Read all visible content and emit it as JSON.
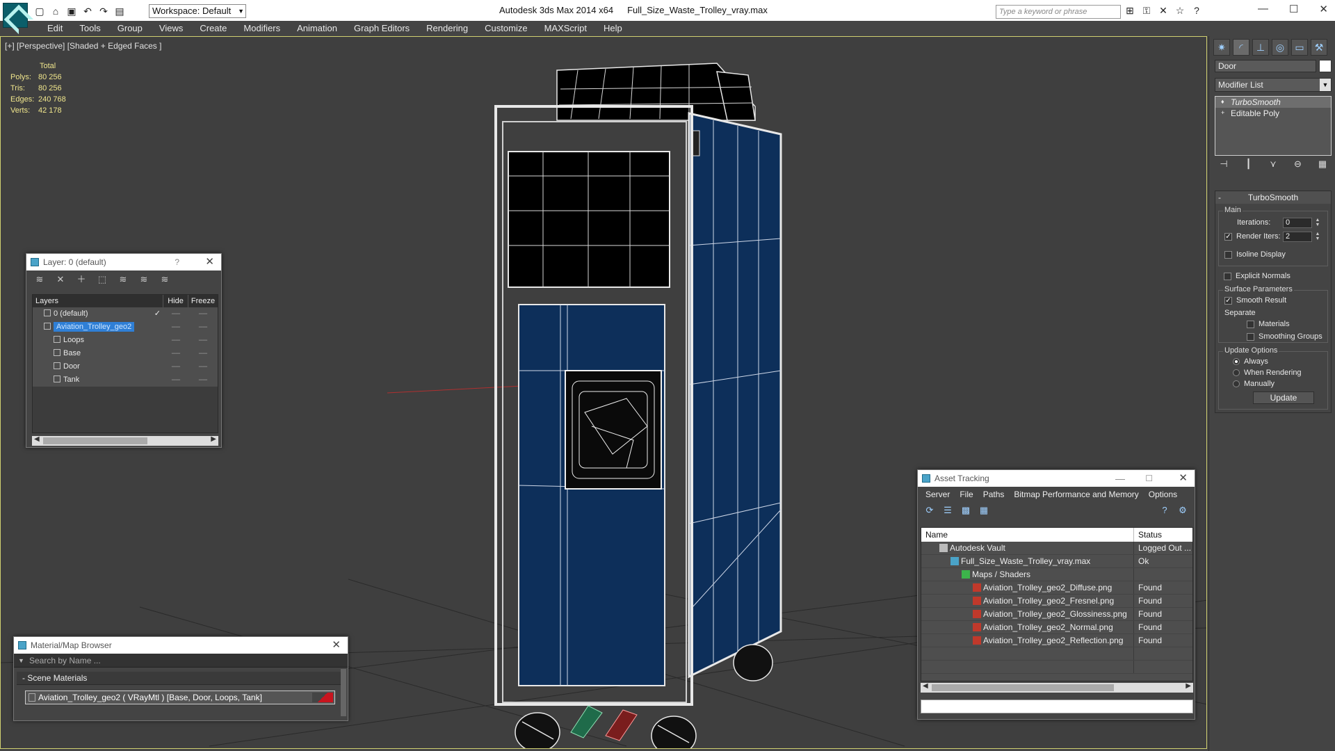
{
  "titlebar": {
    "workspace": "Workspace: Default",
    "app_name": "Autodesk 3ds Max  2014 x64",
    "file_name": "Full_Size_Waste_Trolley_vray.max",
    "search_placeholder": "Type a keyword or phrase"
  },
  "menu": [
    "Edit",
    "Tools",
    "Group",
    "Views",
    "Create",
    "Modifiers",
    "Animation",
    "Graph Editors",
    "Rendering",
    "Customize",
    "MAXScript",
    "Help"
  ],
  "viewport": {
    "label": "[+] [Perspective] [Shaded + Edged Faces ]",
    "stats_header": "Total",
    "stats": [
      {
        "k": "Polys:",
        "v": "80 256"
      },
      {
        "k": "Tris:",
        "v": "80 256"
      },
      {
        "k": "Edges:",
        "v": "240 768"
      },
      {
        "k": "Verts:",
        "v": "42 178"
      }
    ],
    "colors": {
      "background": "#3f3f3f",
      "panel_blue": "#0d2f5a",
      "wire": "#e8e8e8"
    }
  },
  "command_panel": {
    "object_name": "Door",
    "modifier_list": "Modifier List",
    "stack": [
      "TurboSmooth",
      "Editable Poly"
    ],
    "rollout_title": "TurboSmooth",
    "main_label": "Main",
    "iterations_label": "Iterations:",
    "iterations_value": "0",
    "render_iters_label": "Render Iters:",
    "render_iters_value": "2",
    "isoline_label": "Isoline Display",
    "explicit_label": "Explicit Normals",
    "surface_label": "Surface Parameters",
    "smooth_label": "Smooth Result",
    "separate_label": "Separate",
    "materials_label": "Materials",
    "smoothing_groups_label": "Smoothing Groups",
    "update_options_label": "Update Options",
    "always_label": "Always",
    "when_rendering_label": "When Rendering",
    "manually_label": "Manually",
    "update_button": "Update"
  },
  "layer_dialog": {
    "title": "Layer: 0 (default)",
    "help": "?",
    "col_layers": "Layers",
    "col_hide": "Hide",
    "col_freeze": "Freeze",
    "rows": [
      {
        "name": "0 (default)",
        "indent": 16,
        "current": "✓"
      },
      {
        "name": "Aviation_Trolley_geo2",
        "indent": 16,
        "selected": true
      },
      {
        "name": "Loops",
        "indent": 30
      },
      {
        "name": "Base",
        "indent": 30
      },
      {
        "name": "Door",
        "indent": 30
      },
      {
        "name": "Tank",
        "indent": 30
      }
    ]
  },
  "asset_dialog": {
    "title": "Asset Tracking",
    "menu": [
      "Server",
      "File",
      "Paths",
      "Bitmap Performance and Memory",
      "Options"
    ],
    "col_name": "Name",
    "col_status": "Status",
    "rows": [
      {
        "name": "Autodesk Vault",
        "status": "Logged Out ...",
        "indent": 26,
        "icon": "vault-icon"
      },
      {
        "name": "Full_Size_Waste_Trolley_vray.max",
        "status": "Ok",
        "indent": 42,
        "icon": "max-file-icon"
      },
      {
        "name": "Maps / Shaders",
        "status": "",
        "indent": 58,
        "icon": "maps-folder-icon"
      },
      {
        "name": "Aviation_Trolley_geo2_Diffuse.png",
        "status": "Found",
        "indent": 74,
        "icon": "png-icon"
      },
      {
        "name": "Aviation_Trolley_geo2_Fresnel.png",
        "status": "Found",
        "indent": 74,
        "icon": "png-icon"
      },
      {
        "name": "Aviation_Trolley_geo2_Glossiness.png",
        "status": "Found",
        "indent": 74,
        "icon": "png-icon"
      },
      {
        "name": "Aviation_Trolley_geo2_Normal.png",
        "status": "Found",
        "indent": 74,
        "icon": "png-icon"
      },
      {
        "name": "Aviation_Trolley_geo2_Reflection.png",
        "status": "Found",
        "indent": 74,
        "icon": "png-icon"
      }
    ]
  },
  "material_browser": {
    "title": "Material/Map Browser",
    "search_placeholder": "Search by Name ...",
    "group": "- Scene Materials",
    "item": "Aviation_Trolley_geo2  ( VRayMtl )  [Base, Door, Loops, Tank]"
  }
}
